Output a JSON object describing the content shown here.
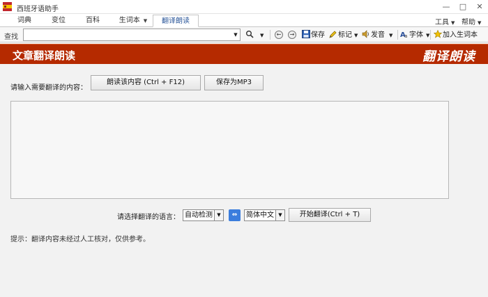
{
  "window": {
    "title": "西班牙语助手",
    "minimize_icon": "minimize-icon",
    "maximize_icon": "maximize-icon",
    "close_icon": "close-icon"
  },
  "tabs": [
    {
      "label": "词典"
    },
    {
      "label": "变位"
    },
    {
      "label": "百科"
    },
    {
      "label": "生词本",
      "has_dropdown": true
    },
    {
      "label": "翻译朗读",
      "active": true
    }
  ],
  "menu": {
    "tools": "工具",
    "help": "帮助"
  },
  "toolbar": {
    "search_label": "查找",
    "search_value": "",
    "save": "保存",
    "mark": "标记",
    "pronounce": "发音",
    "font": "字体",
    "add_vocab": "加入生词本"
  },
  "header": {
    "title": "文章翻译朗读",
    "logo_text": "翻译朗读",
    "background_color": "#b52a00"
  },
  "main": {
    "input_prompt": "请输入需要翻译的内容：",
    "read_button": "朗读该内容 (Ctrl + F12)",
    "save_mp3_button": "保存为MP3",
    "text_content": "",
    "lang_prompt": "请选择翻译的语言：",
    "source_lang": "自动检测",
    "target_lang": "简体中文",
    "translate_button": "开始翻译(Ctrl + T)",
    "hint": "提示：翻译内容未经过人工核对，仅供参考。"
  }
}
